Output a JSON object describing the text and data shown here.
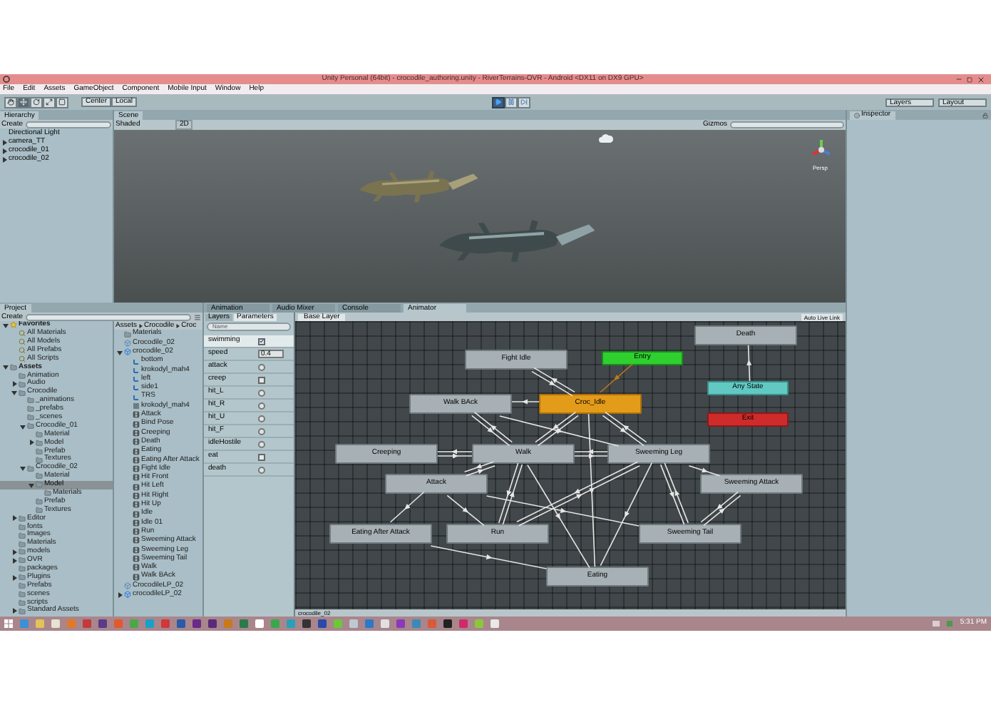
{
  "window": {
    "title": "Unity Personal (64bit) - crocodile_authoring.unity - RiverTerrains-OVR - Android <DX11 on DX9 GPU>"
  },
  "menu": [
    "File",
    "Edit",
    "Assets",
    "GameObject",
    "Component",
    "Mobile Input",
    "Window",
    "Help"
  ],
  "toolbar": {
    "pivot": "Center",
    "space": "Local",
    "layers": "Layers",
    "layout": "Layout"
  },
  "hierarchy": {
    "tab": "Hierarchy",
    "create": "Create",
    "items": [
      {
        "label": "Directional Light"
      },
      {
        "label": "camera_TT",
        "expanded": false
      },
      {
        "label": "crocodile_01",
        "expanded": false
      },
      {
        "label": "crocodile_02",
        "expanded": false
      }
    ]
  },
  "scene": {
    "tab": "Scene",
    "shading": "Shaded",
    "mode_2d": "2D",
    "gizmos": "Gizmos",
    "projection": "Persp"
  },
  "inspector": {
    "tab": "Inspector"
  },
  "project": {
    "tab": "Project",
    "create": "Create",
    "tree": [
      {
        "label": "Favorites",
        "kind": "favorites",
        "expanded": true,
        "selected": false,
        "children": [
          {
            "label": "All Materials",
            "kind": "search",
            "selected": false
          },
          {
            "label": "All Models",
            "kind": "search",
            "selected": false
          },
          {
            "label": "All Prefabs",
            "kind": "search",
            "selected": false
          },
          {
            "label": "All Scripts",
            "kind": "search",
            "selected": false
          }
        ]
      },
      {
        "label": "Assets",
        "kind": "root",
        "expanded": true,
        "selected": false,
        "children": [
          {
            "label": "Animation",
            "kind": "folder",
            "selected": false
          },
          {
            "label": "Audio",
            "kind": "folder",
            "expanded": false,
            "selected": false
          },
          {
            "label": "Crocodile",
            "kind": "folder",
            "expanded": true,
            "selected": false,
            "children": [
              {
                "label": "_animations",
                "kind": "folder",
                "selected": false
              },
              {
                "label": "_prefabs",
                "kind": "folder",
                "selected": false
              },
              {
                "label": "_scenes",
                "kind": "folder",
                "selected": false
              },
              {
                "label": "Crocodile_01",
                "kind": "folder",
                "expanded": true,
                "selected": false,
                "children": [
                  {
                    "label": "Material",
                    "kind": "folder",
                    "selected": false
                  },
                  {
                    "label": "Model",
                    "kind": "folder",
                    "expanded": false,
                    "selected": false
                  },
                  {
                    "label": "Prefab",
                    "kind": "folder",
                    "selected": false
                  },
                  {
                    "label": "Textures",
                    "kind": "folder",
                    "selected": false
                  }
                ]
              },
              {
                "label": "Crocodile_02",
                "kind": "folder",
                "expanded": true,
                "selected": false,
                "children": [
                  {
                    "label": "Material",
                    "kind": "folder",
                    "selected": false
                  },
                  {
                    "label": "Model",
                    "kind": "folder",
                    "expanded": true,
                    "selected": true,
                    "children": [
                      {
                        "label": "Materials",
                        "kind": "folder",
                        "selected": false
                      }
                    ]
                  },
                  {
                    "label": "Prefab",
                    "kind": "folder",
                    "selected": false
                  },
                  {
                    "label": "Textures",
                    "kind": "folder",
                    "selected": false
                  }
                ]
              }
            ]
          },
          {
            "label": "Editor",
            "kind": "folder",
            "expanded": false,
            "selected": false
          },
          {
            "label": "fonts",
            "kind": "folder",
            "selected": false
          },
          {
            "label": "Images",
            "kind": "folder",
            "selected": false
          },
          {
            "label": "Materials",
            "kind": "folder",
            "selected": false
          },
          {
            "label": "models",
            "kind": "folder",
            "expanded": false,
            "selected": false
          },
          {
            "label": "OVR",
            "kind": "folder",
            "expanded": false,
            "selected": false
          },
          {
            "label": "packages",
            "kind": "folder",
            "selected": false
          },
          {
            "label": "Plugins",
            "kind": "folder",
            "expanded": false,
            "selected": false
          },
          {
            "label": "Prefabs",
            "kind": "folder",
            "selected": false
          },
          {
            "label": "scenes",
            "kind": "folder",
            "selected": false
          },
          {
            "label": "scripts",
            "kind": "folder",
            "selected": false
          },
          {
            "label": "Standard Assets",
            "kind": "folder",
            "expanded": false,
            "selected": false
          }
        ]
      }
    ],
    "breadcrumb": [
      "Assets",
      "Crocodile",
      "Croc"
    ],
    "files": [
      {
        "label": "Materials",
        "kind": "folder"
      },
      {
        "label": "Crocodile_02",
        "kind": "prefab"
      },
      {
        "label": "crocodile_02",
        "kind": "model",
        "expanded": true,
        "children": [
          {
            "label": "bottom",
            "kind": "transform"
          },
          {
            "label": "krokodyl_mah4",
            "kind": "transform"
          },
          {
            "label": "left",
            "kind": "transform"
          },
          {
            "label": "side1",
            "kind": "transform"
          },
          {
            "label": "TRS",
            "kind": "transform"
          },
          {
            "label": "krokodyl_mah4",
            "kind": "mesh"
          },
          {
            "label": "Attack",
            "kind": "clip"
          },
          {
            "label": "Bind Pose",
            "kind": "clip"
          },
          {
            "label": "Creeping",
            "kind": "clip"
          },
          {
            "label": "Death",
            "kind": "clip"
          },
          {
            "label": "Eating",
            "kind": "clip"
          },
          {
            "label": "Eating After Attack",
            "kind": "clip"
          },
          {
            "label": "Fight Idle",
            "kind": "clip"
          },
          {
            "label": "Hit Front",
            "kind": "clip"
          },
          {
            "label": "Hit Left",
            "kind": "clip"
          },
          {
            "label": "Hit Right",
            "kind": "clip"
          },
          {
            "label": "Hit Up",
            "kind": "clip"
          },
          {
            "label": "Idle",
            "kind": "clip"
          },
          {
            "label": "Idle 01",
            "kind": "clip"
          },
          {
            "label": "Run",
            "kind": "clip"
          },
          {
            "label": "Sweeming Attack",
            "kind": "clip"
          },
          {
            "label": "Sweeming Leg",
            "kind": "clip"
          },
          {
            "label": "Sweeming Tail",
            "kind": "clip"
          },
          {
            "label": "Walk",
            "kind": "clip"
          },
          {
            "label": "Walk BAck",
            "kind": "clip"
          }
        ]
      },
      {
        "label": "CrocodileLP_02",
        "kind": "prefab"
      },
      {
        "label": "crocodileLP_02",
        "kind": "model",
        "expanded": false
      }
    ]
  },
  "animator": {
    "tabs": [
      {
        "label": "Animation",
        "selected": false
      },
      {
        "label": "Audio Mixer",
        "selected": false
      },
      {
        "label": "Console",
        "selected": false
      },
      {
        "label": "Animator",
        "selected": true
      }
    ],
    "subtabs": [
      {
        "label": "Layers",
        "selected": false
      },
      {
        "label": "Parameters",
        "selected": true
      }
    ],
    "search": {
      "placeholder": "Name"
    },
    "layer": "Base Layer",
    "live_link": "Auto Live Link",
    "parameters": [
      {
        "name": "swimming",
        "kind": "bool",
        "checked": true,
        "selected": true
      },
      {
        "name": "speed",
        "kind": "float",
        "value": "0.4",
        "selected": false
      },
      {
        "name": "attack",
        "kind": "trigger",
        "selected": false
      },
      {
        "name": "creep",
        "kind": "bool",
        "checked": false,
        "selected": false
      },
      {
        "name": "hit_L",
        "kind": "trigger",
        "selected": false
      },
      {
        "name": "hit_R",
        "kind": "trigger",
        "selected": false
      },
      {
        "name": "hit_U",
        "kind": "trigger",
        "selected": false
      },
      {
        "name": "hit_F",
        "kind": "trigger",
        "selected": false
      },
      {
        "name": "idleHostile",
        "kind": "trigger",
        "selected": false
      },
      {
        "name": "eat",
        "kind": "bool",
        "checked": false,
        "selected": false
      },
      {
        "name": "death",
        "kind": "trigger",
        "selected": false
      }
    ],
    "states": [
      {
        "name": "Death",
        "kind": "state"
      },
      {
        "name": "Fight Idle",
        "kind": "state"
      },
      {
        "name": "Entry",
        "kind": "entry"
      },
      {
        "name": "Walk BAck",
        "kind": "state"
      },
      {
        "name": "Croc_Idle",
        "kind": "default"
      },
      {
        "name": "Any State",
        "kind": "any"
      },
      {
        "name": "Exit",
        "kind": "exit"
      },
      {
        "name": "Creeping",
        "kind": "state"
      },
      {
        "name": "Walk",
        "kind": "state"
      },
      {
        "name": "Sweeming Leg",
        "kind": "state"
      },
      {
        "name": "Attack",
        "kind": "state"
      },
      {
        "name": "Sweeming Attack",
        "kind": "state"
      },
      {
        "name": "Eating After Attack",
        "kind": "state"
      },
      {
        "name": "Run",
        "kind": "state"
      },
      {
        "name": "Sweeming Tail",
        "kind": "state"
      },
      {
        "name": "Eating",
        "kind": "state"
      }
    ],
    "status": "crocodile_02"
  },
  "taskbar": {
    "clock": "5:31 PM"
  }
}
